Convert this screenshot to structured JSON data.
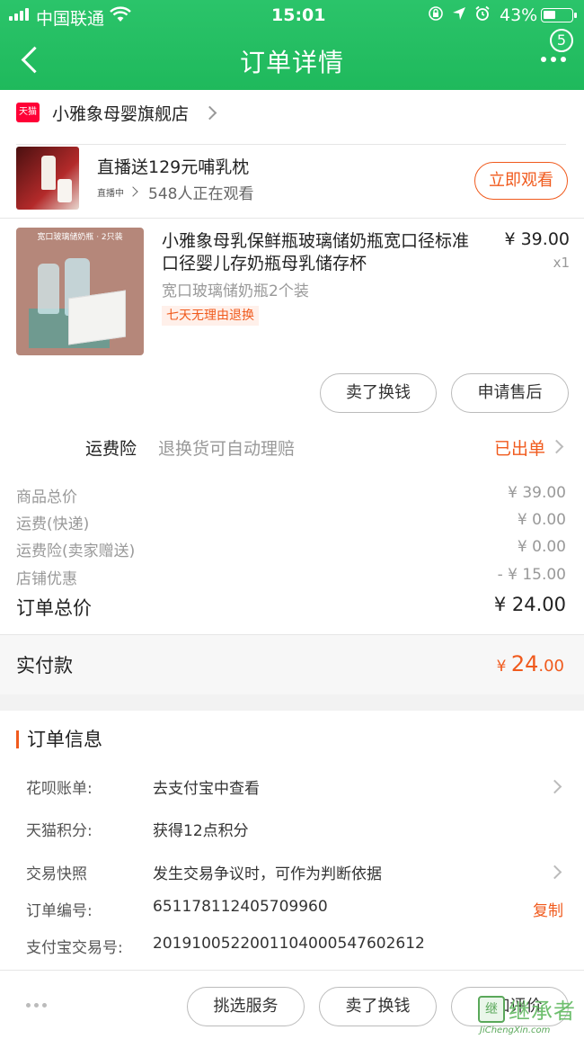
{
  "status_bar": {
    "carrier": "中国联通",
    "time": "15:01",
    "battery": "43%",
    "battery_level": 0.43,
    "icons": [
      "signal-icon",
      "wifi-icon",
      "orientation-lock-icon",
      "location-icon",
      "alarm-icon",
      "battery-icon"
    ]
  },
  "nav": {
    "title": "订单详情",
    "back_icon": "chevron-left-icon",
    "more_icon": "more-icon",
    "badge_count": "5"
  },
  "shop": {
    "badge": "天猫",
    "name": "小雅象母婴旗舰店"
  },
  "live": {
    "title": "直播送129元哺乳枕",
    "tag": "直播中",
    "watching": "548人正在观看",
    "watch_button": "立即观看"
  },
  "product": {
    "image_caption": "宽口玻璃储奶瓶 · 2只装",
    "name": "小雅象母乳保鲜瓶玻璃储奶瓶宽口径标准口径婴儿存奶瓶母乳储存杯",
    "spec": "宽口玻璃储奶瓶2个装",
    "tag": "七天无理由退换",
    "price": "¥ 39.00",
    "quantity": "x1"
  },
  "actions": {
    "sell_button": "卖了换钱",
    "after_sale_button": "申请售后"
  },
  "freight_insurance": {
    "label": "运费险",
    "description": "退换货可自动理赔",
    "status": "已出单"
  },
  "fees": [
    {
      "label": "商品总价",
      "value": "¥ 39.00"
    },
    {
      "label": "运费(快递)",
      "value": "¥ 0.00"
    },
    {
      "label": "运费险(卖家赠送)",
      "value": "¥ 0.00"
    },
    {
      "label": "店铺优惠",
      "value": "- ¥ 15.00"
    }
  ],
  "order_total": {
    "label": "订单总价",
    "value": "¥ 24.00"
  },
  "paid": {
    "label": "实付款",
    "currency": "¥ ",
    "integer": "24",
    "decimal": ".00"
  },
  "order_info": {
    "title": "订单信息",
    "rows": [
      {
        "label": "花呗账单:",
        "value": "去支付宝中查看"
      },
      {
        "label": "天猫积分:",
        "value": "获得12点积分"
      },
      {
        "label": "交易快照",
        "value": "发生交易争议时，可作为判断依据"
      },
      {
        "label": "订单编号:",
        "value": "651178112405709960",
        "action": "复制"
      },
      {
        "label": "支付宝交易号:",
        "value": "2019100522001104000547602612"
      }
    ]
  },
  "bottom_bar": {
    "buttons": [
      "挑选服务",
      "卖了换钱",
      "追加评价"
    ]
  },
  "watermark": {
    "cn": "继承者",
    "en": "JiChengXin.com"
  },
  "colors": {
    "brand_green": "#1fb95c",
    "accent_orange": "#f05a1d",
    "tmall_red": "#ff0036"
  }
}
